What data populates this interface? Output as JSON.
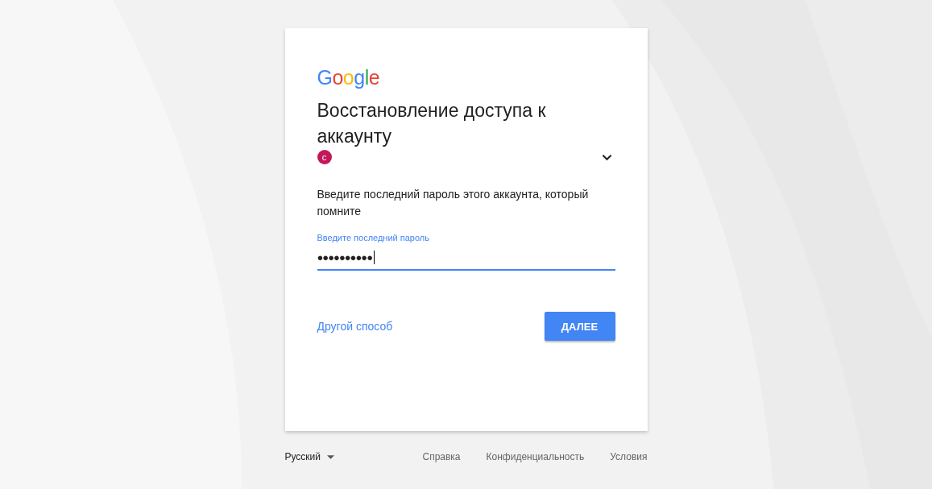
{
  "logo": {
    "letters": [
      {
        "char": "G",
        "color": "#4285f4"
      },
      {
        "char": "o",
        "color": "#ea4335"
      },
      {
        "char": "o",
        "color": "#fbbc05"
      },
      {
        "char": "g",
        "color": "#4285f4"
      },
      {
        "char": "l",
        "color": "#34a853"
      },
      {
        "char": "e",
        "color": "#ea4335"
      }
    ]
  },
  "title": "Восстановление доступа к аккаунту",
  "account": {
    "avatar_letter": "c",
    "color": "#c2185b",
    "expanded": false
  },
  "prompt": "Введите последний пароль этого аккаунта, который помните",
  "password_field": {
    "label": "Введите последний пароль",
    "value": "●●●●●●●●●●",
    "focused": true
  },
  "other_way_link": "Другой способ",
  "next_button": "ДАЛЕЕ",
  "footer": {
    "language": "Русский",
    "links": [
      "Справка",
      "Конфиденциальность",
      "Условия"
    ]
  }
}
